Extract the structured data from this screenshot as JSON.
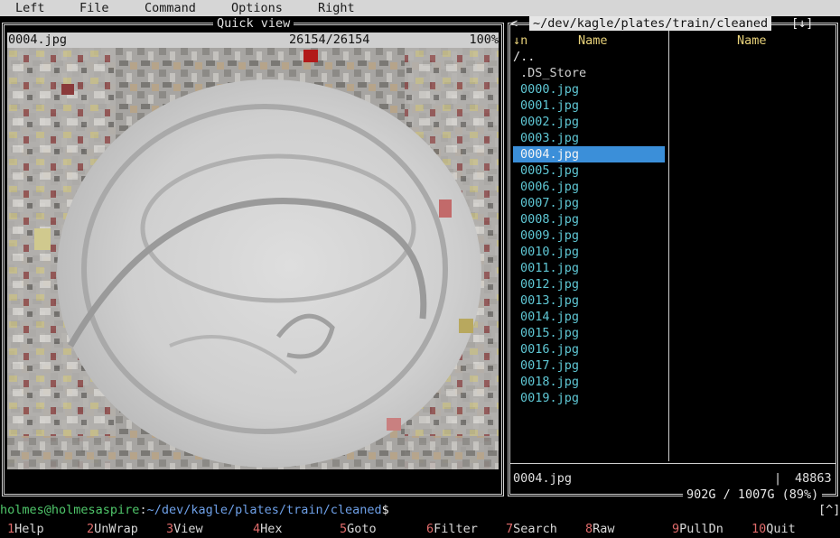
{
  "menu": [
    "Left",
    "File",
    "Command",
    "Options",
    "Right"
  ],
  "quickview": {
    "title": "Quick view",
    "filename": "0004.jpg",
    "position": "26154/26154",
    "percent": "100%"
  },
  "right_panel": {
    "path": "~/dev/kagle/plates/train/cleaned",
    "sort_indicator": "↓n",
    "history_button": "[↓]",
    "col1_header": "Name",
    "col2_header": "Name",
    "files": [
      "/..",
      ".DS_Store",
      "0000.jpg",
      "0001.jpg",
      "0002.jpg",
      "0003.jpg",
      "0004.jpg",
      "0005.jpg",
      "0006.jpg",
      "0007.jpg",
      "0008.jpg",
      "0009.jpg",
      "0010.jpg",
      "0011.jpg",
      "0012.jpg",
      "0013.jpg",
      "0014.jpg",
      "0015.jpg",
      "0016.jpg",
      "0017.jpg",
      "0018.jpg",
      "0019.jpg"
    ],
    "selected_index": 6,
    "status_name": "0004.jpg",
    "status_size": "48863",
    "disk_usage": "902G / 1007G (89%)"
  },
  "prompt": {
    "user_host": "holmes@holmesaspire",
    "sep": ":",
    "path": "~/dev/kagle/plates/train/cleaned",
    "symbol": "$",
    "scroll_indicator": "[^]"
  },
  "keybar": [
    {
      "num": "1",
      "label": "Help"
    },
    {
      "num": "2",
      "label": "UnWrap"
    },
    {
      "num": "3",
      "label": "View"
    },
    {
      "num": "4",
      "label": "Hex"
    },
    {
      "num": "5",
      "label": "Goto"
    },
    {
      "num": "6",
      "label": "Filter"
    },
    {
      "num": "7",
      "label": "Search"
    },
    {
      "num": "8",
      "label": "Raw"
    },
    {
      "num": "9",
      "label": "PullDn"
    },
    {
      "num": "10",
      "label": "Quit"
    }
  ],
  "colors": {
    "menubar": "#d6d6d6",
    "selection": "#3b8fd9",
    "file_text": "#5fc7d4",
    "header_text": "#e8d27a",
    "prompt_user": "#4fc66a",
    "prompt_path": "#6ea0e8",
    "key_number": "#e06b6b"
  }
}
